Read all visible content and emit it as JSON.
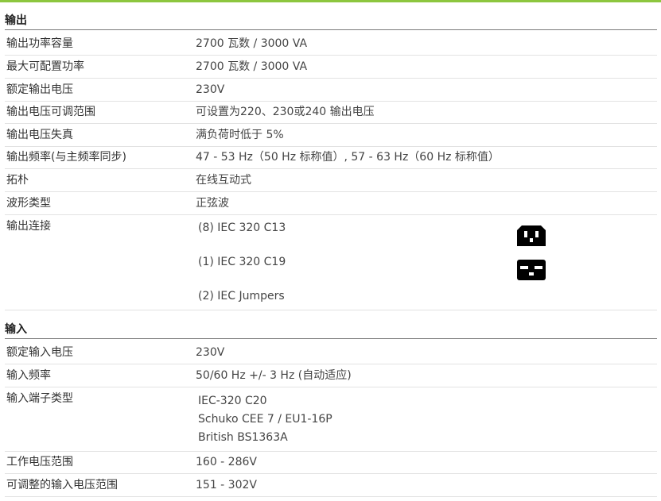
{
  "output": {
    "title": "输出",
    "rows": [
      {
        "label": "输出功率容量",
        "value": "2700 瓦数 / 3000 VA"
      },
      {
        "label": "最大可配置功率",
        "value": "2700 瓦数 / 3000 VA"
      },
      {
        "label": "额定输出电压",
        "value": "230V"
      },
      {
        "label": "输出电压可调范围",
        "value": "可设置为220、230或240 输出电压"
      },
      {
        "label": "输出电压失真",
        "value": "满负荷时低于 5%"
      },
      {
        "label": "输出频率(与主频率同步)",
        "value": "47 - 53 Hz（50 Hz 标称值）, 57 - 63 Hz（60 Hz 标称值）"
      },
      {
        "label": "拓朴",
        "value": "在线互动式"
      },
      {
        "label": "波形类型",
        "value": "正弦波"
      }
    ],
    "connections": {
      "label": "输出连接",
      "items": [
        "(8) IEC 320 C13",
        "(1) IEC 320 C19",
        "(2) IEC Jumpers"
      ],
      "icons": [
        "iec-c13-socket-icon",
        "iec-c19-socket-icon"
      ]
    }
  },
  "input": {
    "title": "输入",
    "rows_top": [
      {
        "label": "额定输入电压",
        "value": "230V"
      },
      {
        "label": "输入频率",
        "value": "50/60 Hz +/- 3 Hz (自动适应)"
      }
    ],
    "connections": {
      "label": "输入端子类型",
      "items": [
        "IEC-320 C20",
        "Schuko CEE 7 / EU1-16P",
        "British BS1363A"
      ]
    },
    "rows_bottom": [
      {
        "label": "工作电压范围",
        "value": "160 - 286V"
      },
      {
        "label": "可调整的输入电压范围",
        "value": "151 - 302V"
      }
    ]
  },
  "colors": {
    "accent": "#8dc63f",
    "icon": "#000000"
  }
}
